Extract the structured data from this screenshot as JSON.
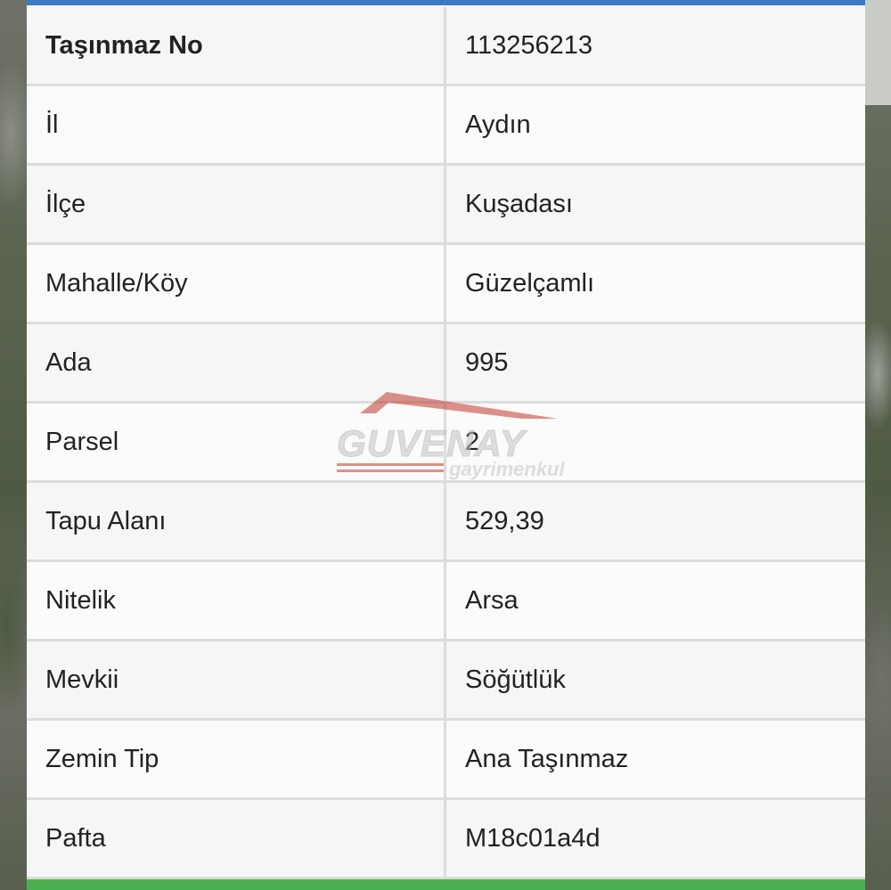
{
  "table": {
    "rows": [
      {
        "label": "Taşınmaz No",
        "value": "113256213"
      },
      {
        "label": "İl",
        "value": "Aydın"
      },
      {
        "label": "İlçe",
        "value": "Kuşadası"
      },
      {
        "label": "Mahalle/Köy",
        "value": "Güzelçamlı"
      },
      {
        "label": "Ada",
        "value": "995"
      },
      {
        "label": "Parsel",
        "value": "2"
      },
      {
        "label": "Tapu Alanı",
        "value": "529,39"
      },
      {
        "label": "Nitelik",
        "value": "Arsa"
      },
      {
        "label": "Mevkii",
        "value": "Söğütlük"
      },
      {
        "label": "Zemin Tip",
        "value": "Ana Taşınmaz"
      },
      {
        "label": "Pafta",
        "value": "M18c01a4d"
      }
    ]
  },
  "watermark": {
    "brand": "GUVENAY",
    "sub": "gayrimenkul"
  },
  "colors": {
    "header_bar": "#3a7cc4",
    "footer_bar": "#4caf50",
    "watermark": "#c0392b"
  }
}
